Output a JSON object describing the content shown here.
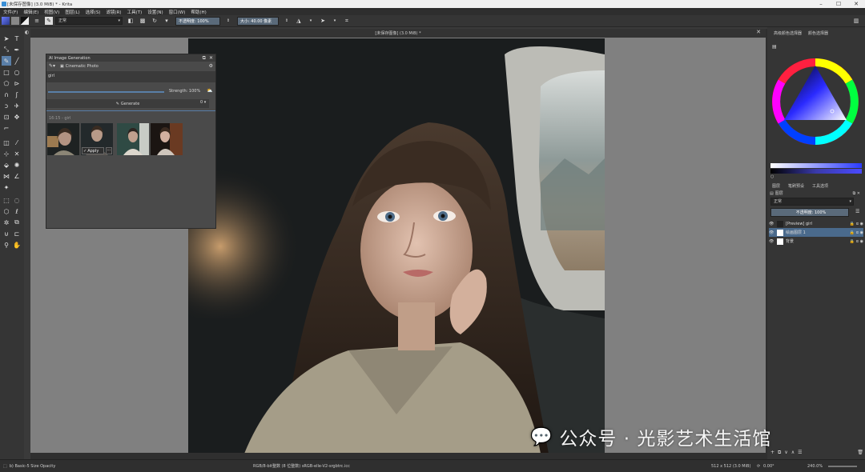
{
  "window": {
    "title": "[未保存图像] (3.0 MiB) * - Krita"
  },
  "menu": [
    "文件(F)",
    "编辑(E)",
    "视图(V)",
    "图层(L)",
    "选择(S)",
    "滤镜(R)",
    "工具(T)",
    "设置(N)",
    "窗口(W)",
    "帮助(H)"
  ],
  "toolbar": {
    "blend_mode": "正常",
    "opacity_label": "不透明度: 100%",
    "size_label": "大小: 40.00 像素"
  },
  "document": {
    "tab_title": "[未保存图像] (3.0 MiB) *"
  },
  "ai_panel": {
    "title": "AI Image Generation",
    "style": "Cinematic Photo",
    "prompt": "girl",
    "strength_label": "Strength: 100%",
    "generate_label": "Generate",
    "count": "0",
    "history_label": "16:15 - girl",
    "apply_label": "Apply"
  },
  "dock": {
    "color_tabs": [
      "高级颜色选择器",
      "颜色选择器"
    ],
    "layer_tabs": [
      "图层",
      "笔刷预设",
      "工具选项"
    ],
    "layers_title": "图层",
    "blend_mode": "正常",
    "opacity_label": "不透明度: 100%",
    "layers": [
      {
        "name": "[Preview] girl",
        "selected": false
      },
      {
        "name": "绘画图层 1",
        "selected": true
      },
      {
        "name": "背景",
        "selected": false
      }
    ]
  },
  "status": {
    "brush": "b) Basic-5 Size Opacity",
    "color_info": "RGB/8-bit整数 (8 位整数) sRGB-elle-V2-srgbtrc.icc",
    "dimensions": "512 x 512 (3.0 MiB)",
    "angle": "0.00°",
    "zoom": "240.0%"
  },
  "watermark": "公众号 · 光影艺术生活馆",
  "colors": {
    "accent": "#5a7fa8",
    "bg": "#353535"
  }
}
